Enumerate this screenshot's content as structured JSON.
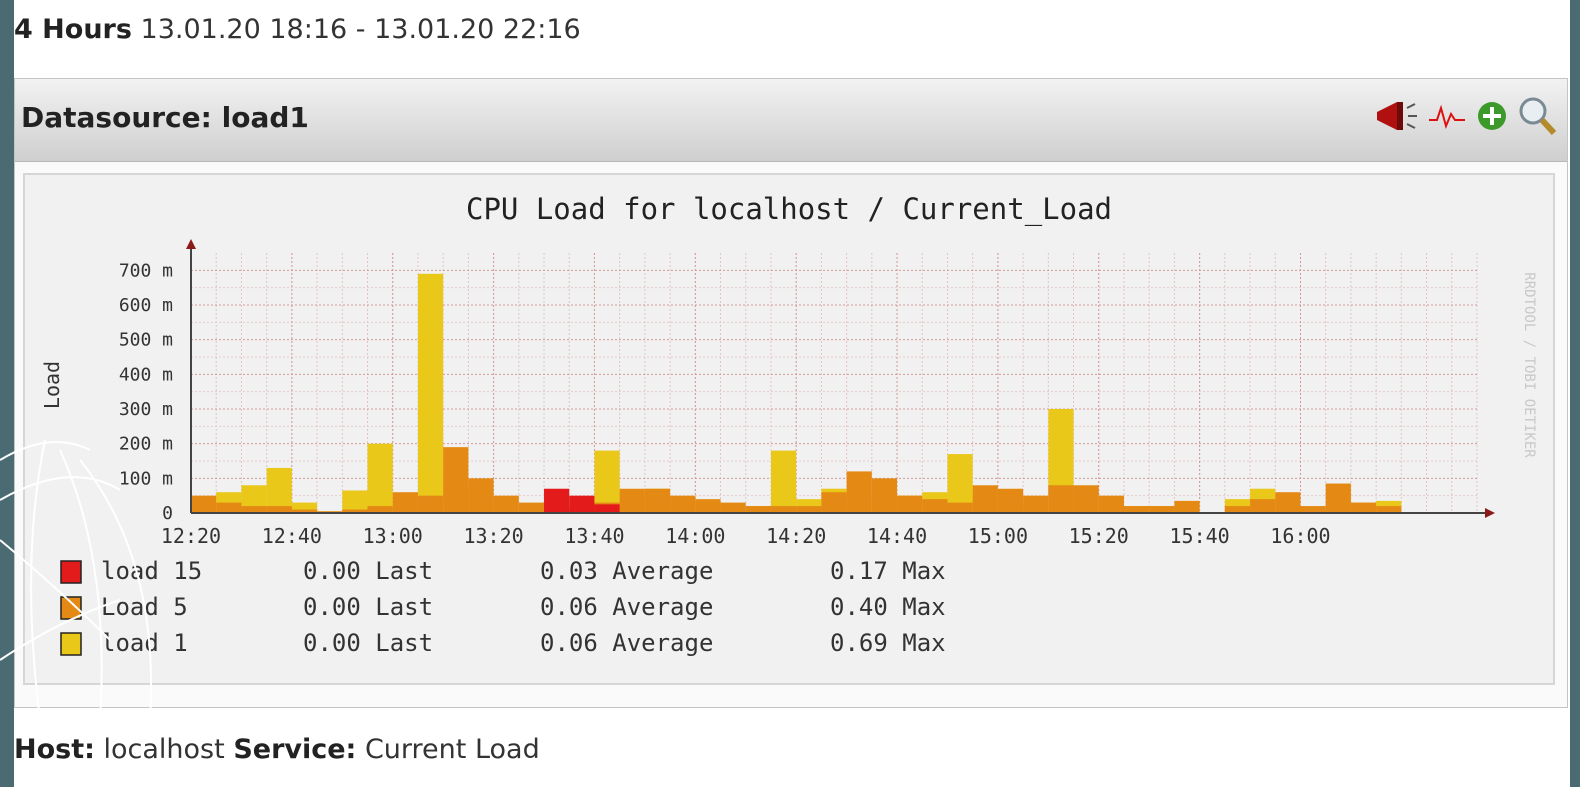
{
  "period": {
    "label": "4 Hours",
    "range": "13.01.20 18:16 - 13.01.20 22:16"
  },
  "datasource": {
    "label": "Datasource:",
    "name": "load1"
  },
  "icons": [
    "alarm-horn-icon",
    "trend-line-icon",
    "add-graph-icon",
    "zoom-icon"
  ],
  "footer": {
    "host_label": "Host:",
    "host": "localhost",
    "service_label": "Service:",
    "service": "Current Load"
  },
  "colors": {
    "load15": "#e31b1b",
    "load5": "#e48a14",
    "load1": "#e9c81a"
  },
  "chart_data": {
    "type": "bar",
    "title": "CPU Load for localhost / Current_Load",
    "ylabel": "Load",
    "watermark": "RRDTOOL / TOBI OETIKER",
    "ylim": [
      0,
      0.75
    ],
    "y_ticks": [
      "0",
      "100 m",
      "200 m",
      "300 m",
      "400 m",
      "500 m",
      "600 m",
      "700 m"
    ],
    "x_ticks": [
      "12:20",
      "12:40",
      "13:00",
      "13:20",
      "13:40",
      "14:00",
      "14:20",
      "14:40",
      "15:00",
      "15:20",
      "15:40",
      "16:00"
    ],
    "x_start": "12:20",
    "x_end": "16:35",
    "step_minutes": 5,
    "grid": true,
    "series": [
      {
        "name": "load 15",
        "color": "#e31b1b",
        "values": [
          0,
          0,
          0,
          0,
          0,
          0,
          0,
          0,
          0,
          0,
          0,
          0,
          0,
          0,
          0.07,
          0.05,
          0.025,
          0,
          0,
          0,
          0,
          0,
          0,
          0,
          0,
          0,
          0,
          0,
          0,
          0,
          0,
          0,
          0,
          0,
          0,
          0,
          0,
          0,
          0,
          0,
          0,
          0,
          0,
          0,
          0,
          0,
          0,
          0,
          0,
          0,
          0,
          0,
          0
        ]
      },
      {
        "name": "Load 5",
        "color": "#e48a14",
        "values": [
          0.05,
          0.03,
          0.02,
          0.02,
          0.01,
          0.005,
          0.01,
          0.02,
          0.06,
          0.05,
          0.19,
          0.1,
          0.05,
          0.03,
          0.02,
          0.01,
          0.03,
          0.07,
          0.07,
          0.05,
          0.04,
          0.03,
          0.02,
          0.02,
          0.02,
          0.06,
          0.12,
          0.1,
          0.05,
          0.04,
          0.03,
          0.08,
          0.07,
          0.05,
          0.08,
          0.08,
          0.05,
          0.02,
          0.02,
          0.035,
          0,
          0.02,
          0.04,
          0.06,
          0.02,
          0.085,
          0.03,
          0.02,
          0,
          0,
          0
        ]
      },
      {
        "name": "load 1",
        "color": "#e9c81a",
        "values": [
          0.02,
          0.06,
          0.08,
          0.13,
          0.03,
          0.005,
          0.065,
          0.2,
          0.03,
          0.69,
          0.075,
          0.03,
          0.02,
          0.01,
          0.01,
          0.02,
          0.18,
          0.05,
          0.07,
          0.03,
          0.02,
          0.02,
          0.02,
          0.18,
          0.04,
          0.07,
          0.04,
          0.03,
          0.05,
          0.06,
          0.17,
          0.06,
          0.05,
          0.03,
          0.3,
          0.04,
          0.02,
          0.02,
          0.02,
          0.03,
          0,
          0.04,
          0.07,
          0.03,
          0,
          0.03,
          0.03,
          0.035,
          0,
          0,
          0
        ]
      }
    ],
    "legend": [
      {
        "name": "load 15",
        "last": "0.00 Last",
        "average": "0.03 Average",
        "max": "0.17 Max"
      },
      {
        "name": "Load 5",
        "last": "0.00 Last",
        "average": "0.06 Average",
        "max": "0.40 Max"
      },
      {
        "name": "load 1",
        "last": "0.00 Last",
        "average": "0.06 Average",
        "max": "0.69 Max"
      }
    ]
  }
}
